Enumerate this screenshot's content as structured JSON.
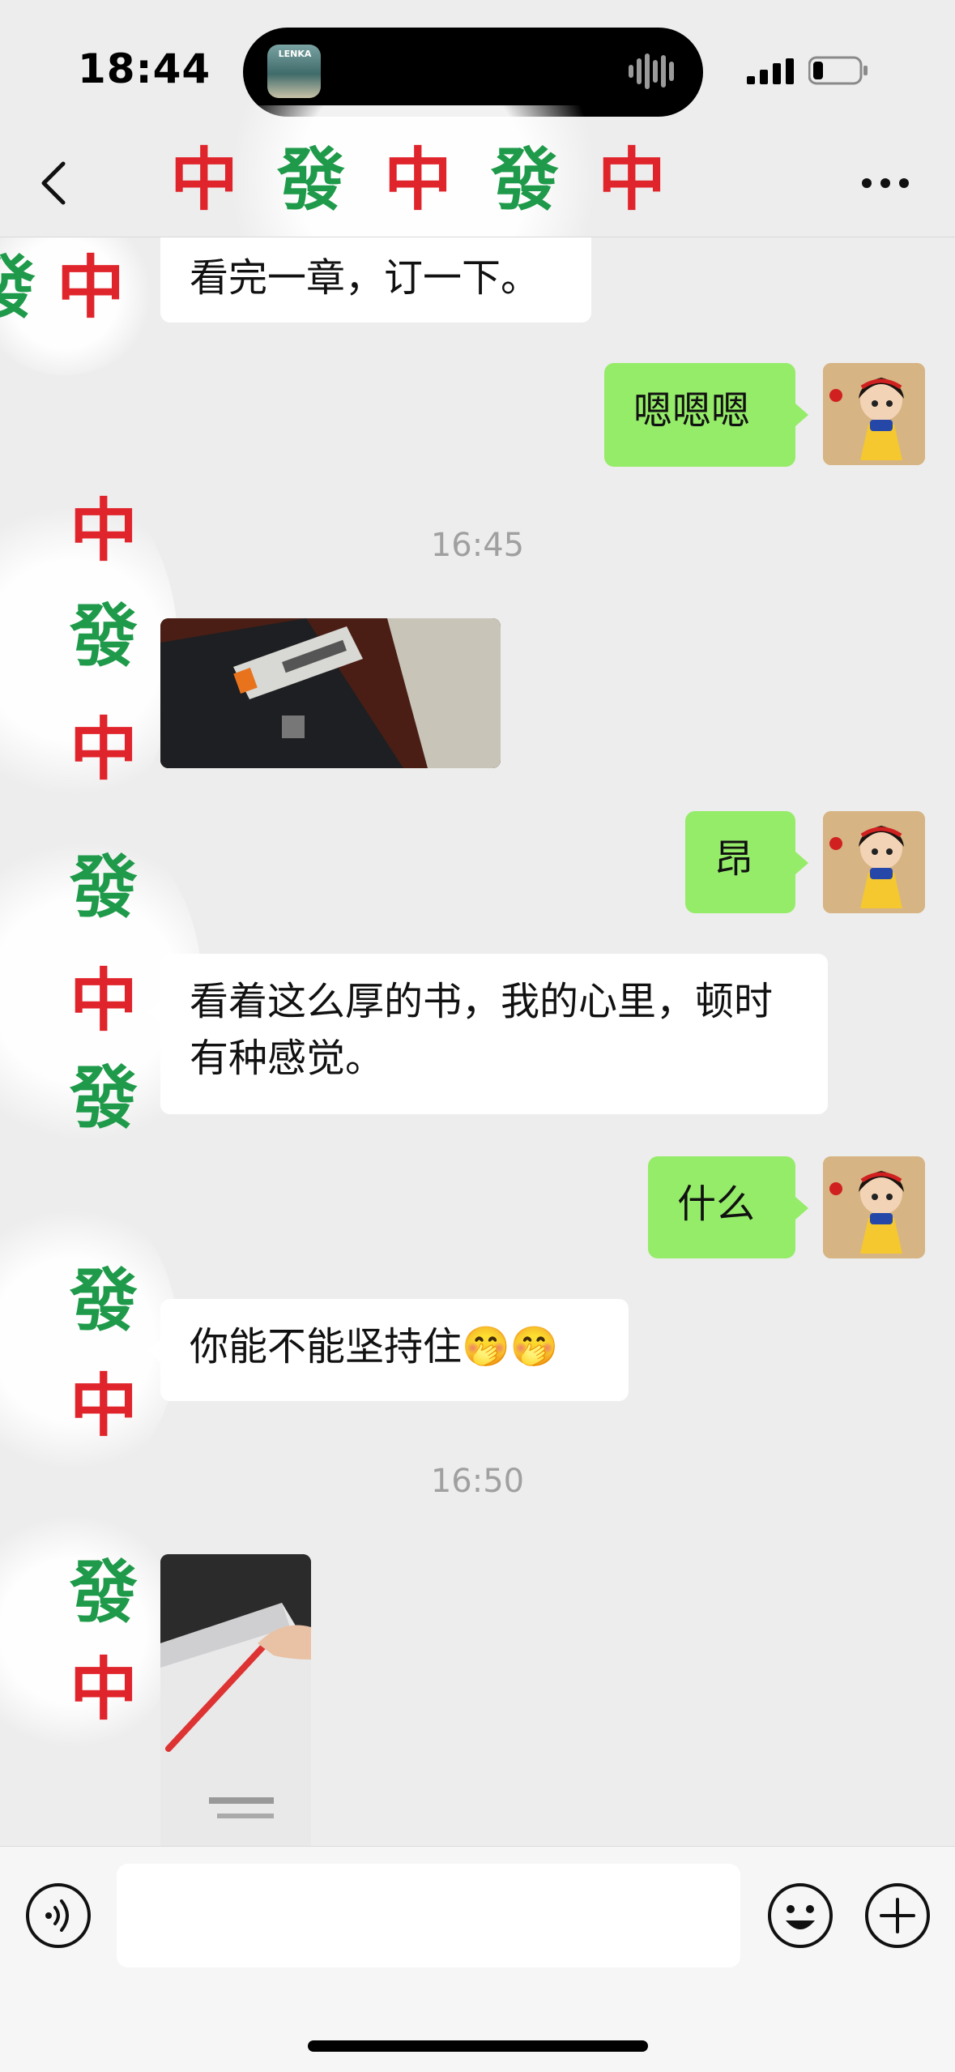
{
  "status_bar": {
    "time": "18:44",
    "now_playing_art_text": "LENKA"
  },
  "nav": {
    "title_tiles": [
      "中",
      "發",
      "中",
      "發",
      "中"
    ]
  },
  "messages": [
    {
      "side": "in",
      "type": "text",
      "text": "看完一章，订一下。"
    },
    {
      "side": "out",
      "type": "text",
      "text": "嗯嗯嗯"
    },
    {
      "type": "timestamp",
      "text": "16:45"
    },
    {
      "side": "in",
      "type": "image",
      "description": "stapler-photo"
    },
    {
      "side": "out",
      "type": "text",
      "text": "昂"
    },
    {
      "side": "in",
      "type": "text",
      "text": "看着这么厚的书，我的心里，顿时有种感觉。"
    },
    {
      "side": "out",
      "type": "text",
      "text": "什么"
    },
    {
      "side": "in",
      "type": "text",
      "text": "你能不能坚持住🤭🤭"
    },
    {
      "type": "timestamp",
      "text": "16:50"
    },
    {
      "side": "in",
      "type": "image",
      "description": "book-photo"
    }
  ],
  "contact_avatar_tiles": [
    "發",
    "中",
    "發",
    "中"
  ],
  "colors": {
    "background": "#ededed",
    "outgoing_bubble": "#95ec69",
    "incoming_bubble": "#ffffff",
    "tile_red": "#e0242b",
    "tile_green": "#1f9a4a"
  },
  "input_bar": {
    "voice_icon": "voice-icon",
    "emoji_icon": "emoji-icon",
    "plus_icon": "plus-icon",
    "text_value": ""
  }
}
